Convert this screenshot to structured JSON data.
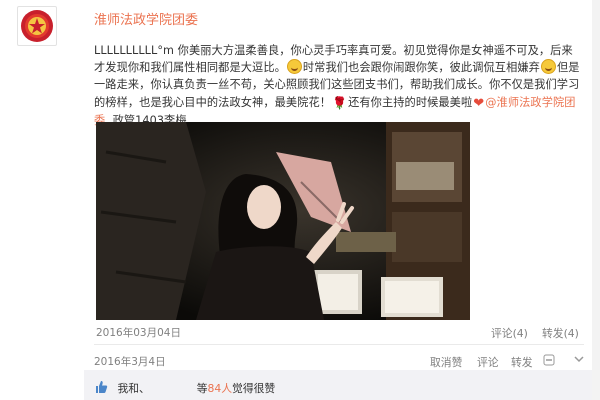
{
  "author": "淮师法政学院团委",
  "post": {
    "text_1": "LLLLLLLLLL°m   你美丽大方温柔善良，你心灵手巧率真可爱。初见觉得你是女神遥不可及，后来才发现你和我们属性相同都是大逗比。",
    "text_2": "时常我们也会跟你闹跟你笑，彼此调侃互相嫌弃",
    "text_3": "但是一路走来，你认真负责一丝不苟，关心照顾我们这些团支书们，帮助我们成长。你不仅是我们学习的榜样，也是我心目中的法政女神，最美院花！",
    "text_4": "还有你主持的时候最美啦",
    "mention": "@淮师法政学院团委",
    "signature": "政管1403李梅"
  },
  "original_meta": {
    "date": "2016年03月04日",
    "comment": "评论(4)",
    "repost": "转发(4)"
  },
  "forward_meta": {
    "date": "2016年3月4日",
    "unfavorite": "取消赞",
    "comment": "评论",
    "repost": "转发"
  },
  "likes": {
    "prefix": "我和、",
    "separator": "等",
    "count": "84人",
    "suffix": "觉得很赞"
  },
  "icons": {
    "avatar": "communist-youth-league-emblem",
    "thumb": "thumbs-up-icon",
    "unlike": "thumbs-up-icon",
    "comment": "comment-icon",
    "repost": "repost-icon",
    "more": "more-icon"
  },
  "colors": {
    "accent": "#eb7350",
    "text": "#333333",
    "muted": "#808080"
  }
}
